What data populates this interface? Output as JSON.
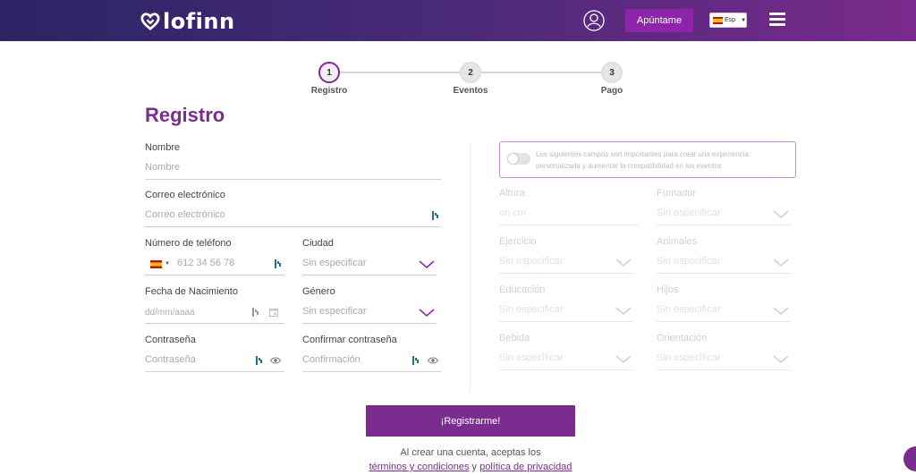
{
  "header": {
    "brand": "lofinn",
    "join_label": "Apúntame",
    "lang_label": "Esp",
    "brand_color": "#7b2c8f"
  },
  "stepper": {
    "steps": [
      {
        "number": "1",
        "label": "Registro"
      },
      {
        "number": "2",
        "label": "Eventos"
      },
      {
        "number": "3",
        "label": "Pago"
      }
    ]
  },
  "page_title": "Registro",
  "left_form": {
    "name": {
      "label": "Nombre",
      "placeholder": "Nombre"
    },
    "email": {
      "label": "Correo electrónico",
      "placeholder": "Correo electrónico"
    },
    "phone": {
      "label": "Número de teléfono",
      "placeholder": "612 34 56 78"
    },
    "city": {
      "label": "Ciudad",
      "placeholder": "Sin especificar"
    },
    "birthdate": {
      "label": "Fecha de Nacimiento",
      "placeholder": "dd/mm/aaaa"
    },
    "gender": {
      "label": "Género",
      "placeholder": "Sin especificar"
    },
    "password": {
      "label": "Contraseña",
      "placeholder": "Contraseña"
    },
    "password_confirm": {
      "label": "Confirmar contraseña",
      "placeholder": "Confirmación"
    }
  },
  "right_form": {
    "notice": "Los siguientes campos son importantes para crear una experiencia personalizada y aumentar la compatibilidad en los eventos",
    "height": {
      "label": "Altura",
      "placeholder": "en cm"
    },
    "smoker": {
      "label": "Fumador",
      "placeholder": "Sin especificar"
    },
    "exercise": {
      "label": "Ejercicio",
      "placeholder": "Sin especificar"
    },
    "animals": {
      "label": "Animales",
      "placeholder": "Sin especificar"
    },
    "education": {
      "label": "Educación",
      "placeholder": "Sin especificar"
    },
    "children": {
      "label": "Hijos",
      "placeholder": "Sin especificar"
    },
    "drink": {
      "label": "Bebida",
      "placeholder": "Sin especificar"
    },
    "orientation": {
      "label": "Orientación",
      "placeholder": "Sin especificar"
    }
  },
  "submit_label": "¡Registrarme!",
  "terms": {
    "intro": "Al crear una cuenta, aceptas los",
    "terms_link": "términos y condiciones",
    "and": " y ",
    "privacy_link": "política de privacidad"
  }
}
